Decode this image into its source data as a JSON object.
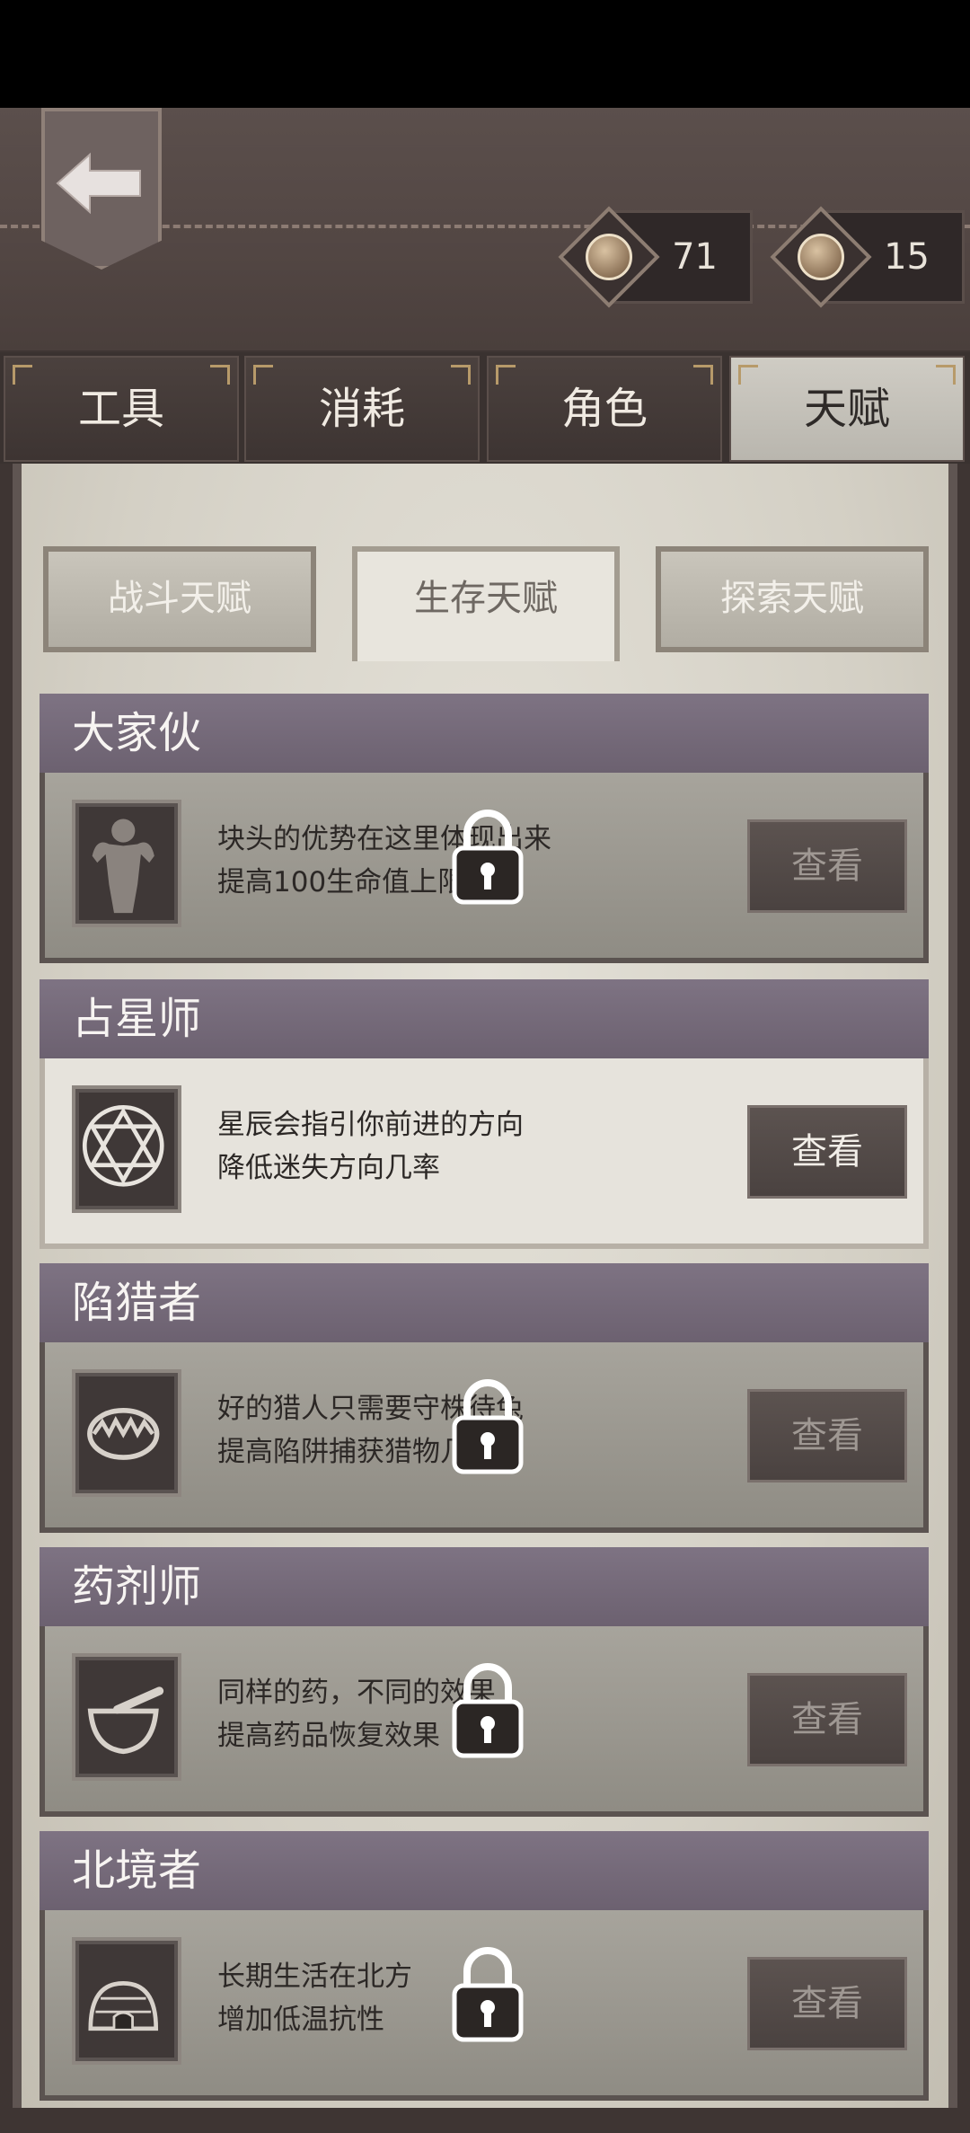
{
  "currency": [
    {
      "icon": "coin-icon",
      "value": "71"
    },
    {
      "icon": "coin-icon",
      "value": "15"
    }
  ],
  "top_tabs": [
    {
      "label": "工具",
      "active": false
    },
    {
      "label": "消耗",
      "active": false
    },
    {
      "label": "角色",
      "active": false
    },
    {
      "label": "天赋",
      "active": true
    }
  ],
  "sub_tabs": [
    {
      "label": "战斗天赋",
      "active": false
    },
    {
      "label": "生存天赋",
      "active": true
    },
    {
      "label": "探索天赋",
      "active": false
    }
  ],
  "talents": [
    {
      "title": "大家伙",
      "line1": "块头的优势在这里体现出来",
      "line2": "提高100生命值上限",
      "locked": true,
      "icon": "muscle-man-icon",
      "button": "查看"
    },
    {
      "title": "占星师",
      "line1": "星辰会指引你前进的方向",
      "line2": "降低迷失方向几率",
      "locked": false,
      "icon": "hexagram-icon",
      "button": "查看"
    },
    {
      "title": "陷猎者",
      "line1": "好的猎人只需要守株待兔",
      "line2": "提高陷阱捕获猎物几率",
      "locked": true,
      "icon": "bear-trap-icon",
      "button": "查看"
    },
    {
      "title": "药剂师",
      "line1": "同样的药，不同的效果",
      "line2": "提高药品恢复效果",
      "locked": true,
      "icon": "mortar-pestle-icon",
      "button": "查看"
    },
    {
      "title": "北境者",
      "line1": "长期生活在北方",
      "line2": "增加低温抗性",
      "locked": true,
      "icon": "igloo-icon",
      "button": "查看"
    }
  ]
}
